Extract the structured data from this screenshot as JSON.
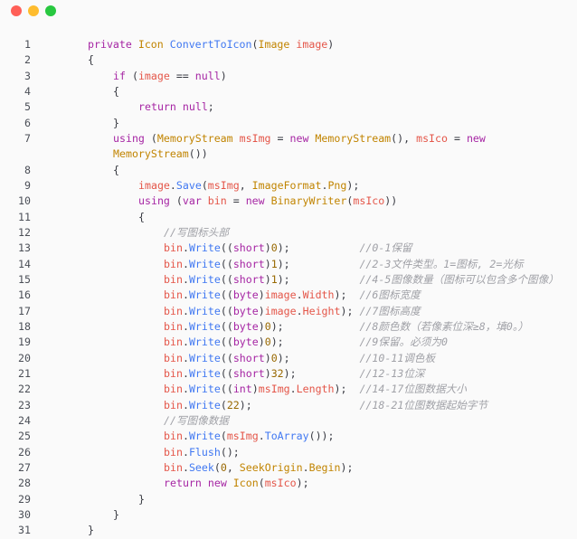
{
  "window": {
    "controls": {
      "close": "#ff5f57",
      "minimize": "#febc2e",
      "zoom": "#28c840"
    }
  },
  "colors": {
    "background": "#fafafa",
    "keyword": "#a626a4",
    "type": "#c18401",
    "function": "#4078f2",
    "number": "#986801",
    "comment": "#a0a1a7",
    "variable": "#e45649",
    "text": "#383a42"
  },
  "lines": [
    {
      "n": "1",
      "indent": 0,
      "tokens": [
        [
          "kw",
          "private "
        ],
        [
          "ty",
          "Icon "
        ],
        [
          "fn",
          "ConvertToIcon"
        ],
        [
          "pl",
          "("
        ],
        [
          "ty",
          "Image "
        ],
        [
          "var",
          "image"
        ],
        [
          "pl",
          ")"
        ]
      ]
    },
    {
      "n": "2",
      "indent": 0,
      "tokens": [
        [
          "pl",
          "{"
        ]
      ]
    },
    {
      "n": "3",
      "indent": 1,
      "tokens": [
        [
          "kw",
          "if "
        ],
        [
          "pl",
          "("
        ],
        [
          "var",
          "image "
        ],
        [
          "pl",
          "== "
        ],
        [
          "kw",
          "null"
        ],
        [
          "pl",
          ")"
        ]
      ]
    },
    {
      "n": "4",
      "indent": 1,
      "tokens": [
        [
          "pl",
          "{"
        ]
      ]
    },
    {
      "n": "5",
      "indent": 2,
      "tokens": [
        [
          "kw",
          "return "
        ],
        [
          "kw",
          "null"
        ],
        [
          "pl",
          ";"
        ]
      ]
    },
    {
      "n": "6",
      "indent": 1,
      "tokens": [
        [
          "pl",
          "}"
        ]
      ]
    },
    {
      "n": "7",
      "indent": 1,
      "wrapped": true,
      "tokens": [
        [
          "kw",
          "using "
        ],
        [
          "pl",
          "("
        ],
        [
          "ty",
          "MemoryStream "
        ],
        [
          "var",
          "msImg "
        ],
        [
          "pl",
          "= "
        ],
        [
          "kw",
          "new "
        ],
        [
          "ty",
          "MemoryStream"
        ],
        [
          "pl",
          "(), "
        ],
        [
          "var",
          "msIco "
        ],
        [
          "pl",
          "= "
        ],
        [
          "kw",
          "new"
        ]
      ],
      "cont": [
        [
          "ty",
          "MemoryStream"
        ],
        [
          "pl",
          "())"
        ]
      ]
    },
    {
      "n": "8",
      "indent": 1,
      "tokens": [
        [
          "pl",
          "{"
        ]
      ]
    },
    {
      "n": "9",
      "indent": 2,
      "tokens": [
        [
          "var",
          "image"
        ],
        [
          "pl",
          "."
        ],
        [
          "fn",
          "Save"
        ],
        [
          "pl",
          "("
        ],
        [
          "var",
          "msImg"
        ],
        [
          "pl",
          ", "
        ],
        [
          "ty",
          "ImageFormat"
        ],
        [
          "pl",
          "."
        ],
        [
          "ty",
          "Png"
        ],
        [
          "pl",
          ");"
        ]
      ]
    },
    {
      "n": "10",
      "indent": 2,
      "tokens": [
        [
          "kw",
          "using "
        ],
        [
          "pl",
          "("
        ],
        [
          "kw",
          "var "
        ],
        [
          "var",
          "bin "
        ],
        [
          "pl",
          "= "
        ],
        [
          "kw",
          "new "
        ],
        [
          "ty",
          "BinaryWriter"
        ],
        [
          "pl",
          "("
        ],
        [
          "var",
          "msIco"
        ],
        [
          "pl",
          "))"
        ]
      ]
    },
    {
      "n": "11",
      "indent": 2,
      "tokens": [
        [
          "pl",
          "{"
        ]
      ]
    },
    {
      "n": "12",
      "indent": 3,
      "tokens": [
        [
          "cm",
          "//写图标头部"
        ]
      ]
    },
    {
      "n": "13",
      "indent": 3,
      "tokens": [
        [
          "var",
          "bin"
        ],
        [
          "pl",
          "."
        ],
        [
          "fn",
          "Write"
        ],
        [
          "pl",
          "(("
        ],
        [
          "kw",
          "short"
        ],
        [
          "pl",
          ")"
        ],
        [
          "num",
          "0"
        ],
        [
          "pl",
          ");"
        ],
        [
          "pl",
          "           "
        ],
        [
          "cm",
          "//0-1保留"
        ]
      ]
    },
    {
      "n": "14",
      "indent": 3,
      "tokens": [
        [
          "var",
          "bin"
        ],
        [
          "pl",
          "."
        ],
        [
          "fn",
          "Write"
        ],
        [
          "pl",
          "(("
        ],
        [
          "kw",
          "short"
        ],
        [
          "pl",
          ")"
        ],
        [
          "num",
          "1"
        ],
        [
          "pl",
          ");"
        ],
        [
          "pl",
          "           "
        ],
        [
          "cm",
          "//2-3文件类型。1=图标, 2=光标"
        ]
      ]
    },
    {
      "n": "15",
      "indent": 3,
      "tokens": [
        [
          "var",
          "bin"
        ],
        [
          "pl",
          "."
        ],
        [
          "fn",
          "Write"
        ],
        [
          "pl",
          "(("
        ],
        [
          "kw",
          "short"
        ],
        [
          "pl",
          ")"
        ],
        [
          "num",
          "1"
        ],
        [
          "pl",
          ");"
        ],
        [
          "pl",
          "           "
        ],
        [
          "cm",
          "//4-5图像数量（图标可以包含多个图像）"
        ]
      ]
    },
    {
      "n": "16",
      "indent": 3,
      "tokens": [
        [
          "var",
          "bin"
        ],
        [
          "pl",
          "."
        ],
        [
          "fn",
          "Write"
        ],
        [
          "pl",
          "(("
        ],
        [
          "kw",
          "byte"
        ],
        [
          "pl",
          ")"
        ],
        [
          "var",
          "image"
        ],
        [
          "pl",
          "."
        ],
        [
          "var",
          "Width"
        ],
        [
          "pl",
          ");"
        ],
        [
          "pl",
          "  "
        ],
        [
          "cm",
          "//6图标宽度"
        ]
      ]
    },
    {
      "n": "17",
      "indent": 3,
      "tokens": [
        [
          "var",
          "bin"
        ],
        [
          "pl",
          "."
        ],
        [
          "fn",
          "Write"
        ],
        [
          "pl",
          "(("
        ],
        [
          "kw",
          "byte"
        ],
        [
          "pl",
          ")"
        ],
        [
          "var",
          "image"
        ],
        [
          "pl",
          "."
        ],
        [
          "var",
          "Height"
        ],
        [
          "pl",
          ");"
        ],
        [
          "pl",
          " "
        ],
        [
          "cm",
          "//7图标高度"
        ]
      ]
    },
    {
      "n": "18",
      "indent": 3,
      "tokens": [
        [
          "var",
          "bin"
        ],
        [
          "pl",
          "."
        ],
        [
          "fn",
          "Write"
        ],
        [
          "pl",
          "(("
        ],
        [
          "kw",
          "byte"
        ],
        [
          "pl",
          ")"
        ],
        [
          "num",
          "0"
        ],
        [
          "pl",
          ");"
        ],
        [
          "pl",
          "            "
        ],
        [
          "cm",
          "//8颜色数（若像素位深≥8，填0。）"
        ]
      ]
    },
    {
      "n": "19",
      "indent": 3,
      "tokens": [
        [
          "var",
          "bin"
        ],
        [
          "pl",
          "."
        ],
        [
          "fn",
          "Write"
        ],
        [
          "pl",
          "(("
        ],
        [
          "kw",
          "byte"
        ],
        [
          "pl",
          ")"
        ],
        [
          "num",
          "0"
        ],
        [
          "pl",
          ");"
        ],
        [
          "pl",
          "            "
        ],
        [
          "cm",
          "//9保留。必须为0"
        ]
      ]
    },
    {
      "n": "20",
      "indent": 3,
      "tokens": [
        [
          "var",
          "bin"
        ],
        [
          "pl",
          "."
        ],
        [
          "fn",
          "Write"
        ],
        [
          "pl",
          "(("
        ],
        [
          "kw",
          "short"
        ],
        [
          "pl",
          ")"
        ],
        [
          "num",
          "0"
        ],
        [
          "pl",
          ");"
        ],
        [
          "pl",
          "           "
        ],
        [
          "cm",
          "//10-11调色板"
        ]
      ]
    },
    {
      "n": "21",
      "indent": 3,
      "tokens": [
        [
          "var",
          "bin"
        ],
        [
          "pl",
          "."
        ],
        [
          "fn",
          "Write"
        ],
        [
          "pl",
          "(("
        ],
        [
          "kw",
          "short"
        ],
        [
          "pl",
          ")"
        ],
        [
          "num",
          "32"
        ],
        [
          "pl",
          ");"
        ],
        [
          "pl",
          "          "
        ],
        [
          "cm",
          "//12-13位深"
        ]
      ]
    },
    {
      "n": "22",
      "indent": 3,
      "tokens": [
        [
          "var",
          "bin"
        ],
        [
          "pl",
          "."
        ],
        [
          "fn",
          "Write"
        ],
        [
          "pl",
          "(("
        ],
        [
          "kw",
          "int"
        ],
        [
          "pl",
          ")"
        ],
        [
          "var",
          "msImg"
        ],
        [
          "pl",
          "."
        ],
        [
          "var",
          "Length"
        ],
        [
          "pl",
          ");"
        ],
        [
          "pl",
          "  "
        ],
        [
          "cm",
          "//14-17位图数据大小"
        ]
      ]
    },
    {
      "n": "23",
      "indent": 3,
      "tokens": [
        [
          "var",
          "bin"
        ],
        [
          "pl",
          "."
        ],
        [
          "fn",
          "Write"
        ],
        [
          "pl",
          "("
        ],
        [
          "num",
          "22"
        ],
        [
          "pl",
          ");"
        ],
        [
          "pl",
          "                 "
        ],
        [
          "cm",
          "//18-21位图数据起始字节"
        ]
      ]
    },
    {
      "n": "24",
      "indent": 3,
      "tokens": [
        [
          "cm",
          "//写图像数据"
        ]
      ]
    },
    {
      "n": "25",
      "indent": 3,
      "tokens": [
        [
          "var",
          "bin"
        ],
        [
          "pl",
          "."
        ],
        [
          "fn",
          "Write"
        ],
        [
          "pl",
          "("
        ],
        [
          "var",
          "msImg"
        ],
        [
          "pl",
          "."
        ],
        [
          "fn",
          "ToArray"
        ],
        [
          "pl",
          "());"
        ]
      ]
    },
    {
      "n": "26",
      "indent": 3,
      "tokens": [
        [
          "var",
          "bin"
        ],
        [
          "pl",
          "."
        ],
        [
          "fn",
          "Flush"
        ],
        [
          "pl",
          "();"
        ]
      ]
    },
    {
      "n": "27",
      "indent": 3,
      "tokens": [
        [
          "var",
          "bin"
        ],
        [
          "pl",
          "."
        ],
        [
          "fn",
          "Seek"
        ],
        [
          "pl",
          "("
        ],
        [
          "num",
          "0"
        ],
        [
          "pl",
          ", "
        ],
        [
          "ty",
          "SeekOrigin"
        ],
        [
          "pl",
          "."
        ],
        [
          "ty",
          "Begin"
        ],
        [
          "pl",
          ");"
        ]
      ]
    },
    {
      "n": "28",
      "indent": 3,
      "tokens": [
        [
          "kw",
          "return "
        ],
        [
          "kw",
          "new "
        ],
        [
          "ty",
          "Icon"
        ],
        [
          "pl",
          "("
        ],
        [
          "var",
          "msIco"
        ],
        [
          "pl",
          ");"
        ]
      ]
    },
    {
      "n": "29",
      "indent": 2,
      "tokens": [
        [
          "pl",
          "}"
        ]
      ]
    },
    {
      "n": "30",
      "indent": 1,
      "tokens": [
        [
          "pl",
          "}"
        ]
      ]
    },
    {
      "n": "31",
      "indent": 0,
      "tokens": [
        [
          "pl",
          "}"
        ]
      ]
    }
  ]
}
